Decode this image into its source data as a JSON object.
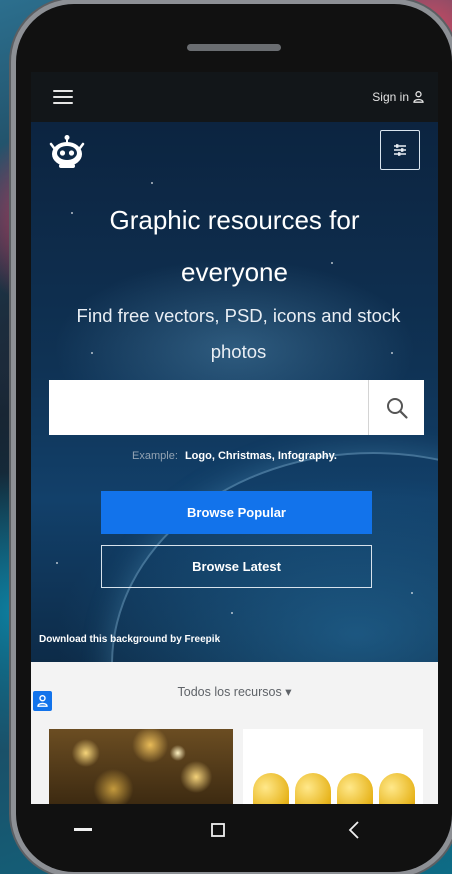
{
  "topbar": {
    "signin_label": "Sign in"
  },
  "hero": {
    "headline_line1": "Graphic resources for",
    "headline_line2": "everyone",
    "subline_line1": "Find free vectors, PSD, icons and stock",
    "subline_line2": "photos",
    "search": {
      "value": "",
      "placeholder": ""
    },
    "examples": {
      "label": "Example:",
      "items": [
        "Logo,",
        "Christmas,",
        "Infography."
      ]
    },
    "browse_popular_label": "Browse Popular",
    "browse_latest_label": "Browse Latest",
    "credit_text": "Download this background by Freepik"
  },
  "content": {
    "filter_label": "Todos los recursos ▾"
  },
  "colors": {
    "accent": "#1273eb",
    "topbar_bg": "#121619",
    "content_bg": "#f3f3f3"
  },
  "icons": {
    "menu": "hamburger-icon",
    "user": "user-icon",
    "logo": "robot-logo-icon",
    "filter": "sliders-icon",
    "search": "search-icon",
    "back": "back-icon",
    "home": "home-icon",
    "recents": "recents-icon"
  }
}
